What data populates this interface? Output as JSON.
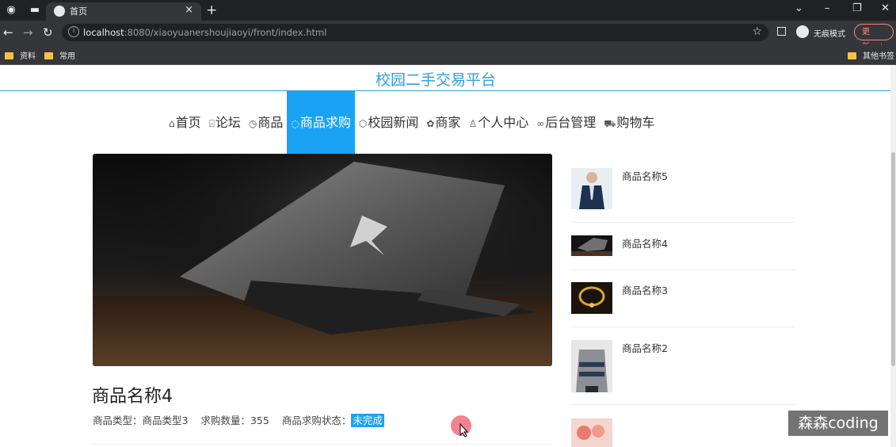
{
  "browser": {
    "tab_title": "首页",
    "tab_close": "×",
    "new_tab": "+",
    "url_host": "localhost",
    "url_rest": ":8080/xiaoyuanershoujiaoyi/front/index.html",
    "incognito_label": "无痕模式",
    "update_label": "更新",
    "bookmarks": [
      "资料",
      "常用"
    ],
    "other_bookmarks": "其他书签"
  },
  "site": {
    "title": "校园二手交易平台",
    "menu": [
      {
        "icon": "⌂",
        "label": "首页"
      },
      {
        "icon": "⌸",
        "label": "论坛"
      },
      {
        "icon": "◷",
        "label": "商品"
      },
      {
        "icon": "◌",
        "label": "商品求购"
      },
      {
        "icon": "⬡",
        "label": "校园新闻"
      },
      {
        "icon": "✿",
        "label": "商家"
      },
      {
        "icon": "♙",
        "label": "个人中心"
      },
      {
        "icon": "∞",
        "label": "后台管理"
      },
      {
        "icon": "⛟",
        "label": "购物车"
      }
    ],
    "active_menu_index": 3,
    "accent_color": "#1aa3f5"
  },
  "product": {
    "name": "商品名称4",
    "type_label": "商品类型：",
    "type_value": "商品类型3",
    "qty_label": "求购数量：",
    "qty_value": "355",
    "status_label": "商品求购状态：",
    "status_value": "未完成"
  },
  "sidebar": {
    "items": [
      {
        "name": "商品名称5"
      },
      {
        "name": "商品名称4"
      },
      {
        "name": "商品名称3"
      },
      {
        "name": "商品名称2"
      },
      {
        "name": ""
      }
    ]
  },
  "watermark": "森森coding"
}
